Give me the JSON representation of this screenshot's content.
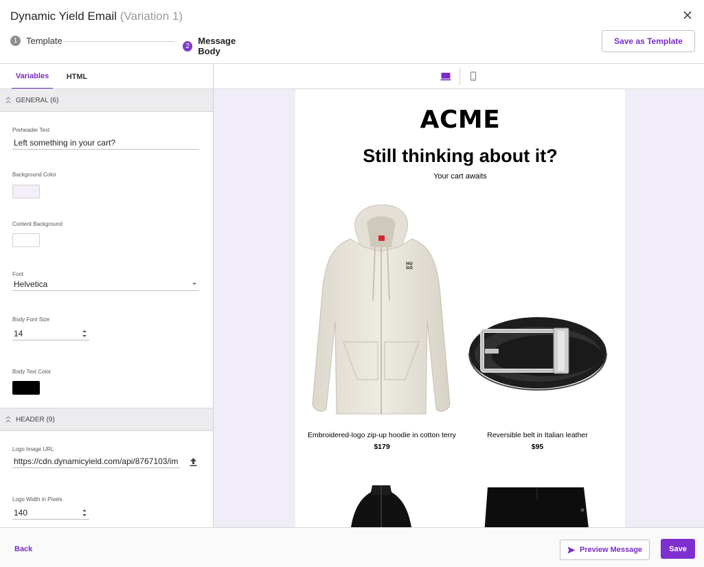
{
  "header": {
    "title": "Dynamic Yield Email",
    "variation": "(Variation 1)",
    "steps": [
      {
        "number": "1",
        "label": "Template"
      },
      {
        "number": "2",
        "label": "Message Body"
      }
    ],
    "save_template_label": "Save as Template",
    "close_icon": "close-icon"
  },
  "tabs": [
    {
      "label": "Variables",
      "active": true
    },
    {
      "label": "HTML",
      "active": false
    }
  ],
  "sections": {
    "general": {
      "title": "GENERAL (6)",
      "fields": {
        "preheader": {
          "label": "Preheader Text",
          "value": "Left something in your cart?"
        },
        "background_color": {
          "label": "Background Color",
          "value": "#f3eefa"
        },
        "content_background": {
          "label": "Content Background",
          "value": "#ffffff"
        },
        "font": {
          "label": "Font",
          "value": "Helvetica"
        },
        "body_font_size": {
          "label": "Body Font Size",
          "value": "14"
        },
        "body_text_color": {
          "label": "Body Text Color",
          "value": "#000000"
        }
      }
    },
    "header": {
      "title": "HEADER (9)",
      "fields": {
        "logo_url": {
          "label": "Logo Image URL",
          "value": "https://cdn.dynamicyield.com/api/8767103/im"
        },
        "logo_width": {
          "label": "Logo Width in Pixels",
          "value": "140"
        }
      }
    }
  },
  "preview": {
    "devices": [
      "desktop-icon",
      "mobile-icon"
    ],
    "email": {
      "logo": "ACME",
      "headline": "Still thinking about it?",
      "subline": "Your cart awaits",
      "products": [
        {
          "name": "Embroidered-logo zip-up hoodie in cotton terry",
          "price": "$179"
        },
        {
          "name": "Reversible belt in Italian leather",
          "price": "$95"
        }
      ]
    }
  },
  "footer": {
    "back_label": "Back",
    "preview_label": "Preview Message",
    "save_label": "Save"
  },
  "colors": {
    "accent": "#7a2cc7",
    "preview_bg": "#f1edf8"
  }
}
